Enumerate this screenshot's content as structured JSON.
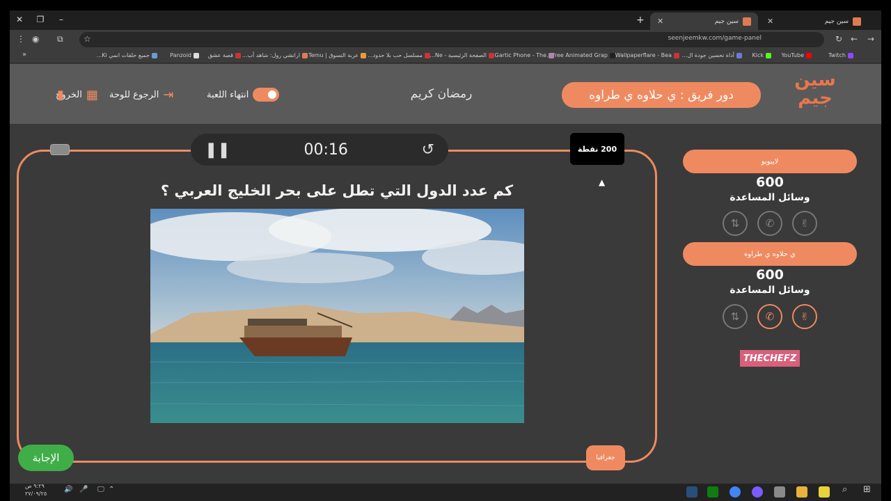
{
  "browser": {
    "tabs": [
      {
        "title": "سين جيم",
        "active": true
      },
      {
        "title": "سين جيم",
        "active": false
      }
    ],
    "url": "seenjeemkw.com/game-panel",
    "bookmarks": [
      "Twitch",
      "YouTube",
      "Kick",
      "أداة تحسين جودة ال...",
      "Wallpaperflare - Bea...",
      "Free Animated Grap...",
      "Gartic Phone - The...",
      "الصفحة الرئيسية - Ne...",
      "مسلسل حب بلا حدود...",
      "عربة التسوق | Temu",
      "ارانشي رول: شاهد أب...",
      "قصة عشق",
      "Panzoid",
      "جميع حلقات انمي Ki..."
    ]
  },
  "header": {
    "logo": "سين جيم",
    "turn_label": "دور فريق : ي حلاوه ي طراوه",
    "game_title": "رمضان كريم",
    "end_game": "انتهاء اللعبة",
    "back_to_board": "الرجوع للوحة",
    "exit": "الخروج"
  },
  "board": {
    "timer": "00:16",
    "points": "200 نقطة",
    "question": "كم عدد الدول التي تطل على بحر الخليج العربي ؟",
    "answer_button": "الإجابة",
    "category": "جغرافيا"
  },
  "teams": [
    {
      "name": "لايبوبو",
      "score": "600",
      "helps_label": "وسائل المساعدة",
      "helps_active": false
    },
    {
      "name": "ي حلاوه ي طراوه",
      "score": "600",
      "helps_label": "وسائل المساعدة",
      "helps_active": true
    }
  ],
  "sponsor": {
    "the": "THE",
    "chefz": "CHEFZ"
  },
  "taskbar": {
    "time": "٩:٢٩ ص",
    "date": "٢٧/٠٩/٢٥"
  },
  "colors": {
    "accent": "#ef8a60",
    "answer": "#3fae49",
    "background": "#3a3a3a",
    "header": "#5a5a5a"
  }
}
